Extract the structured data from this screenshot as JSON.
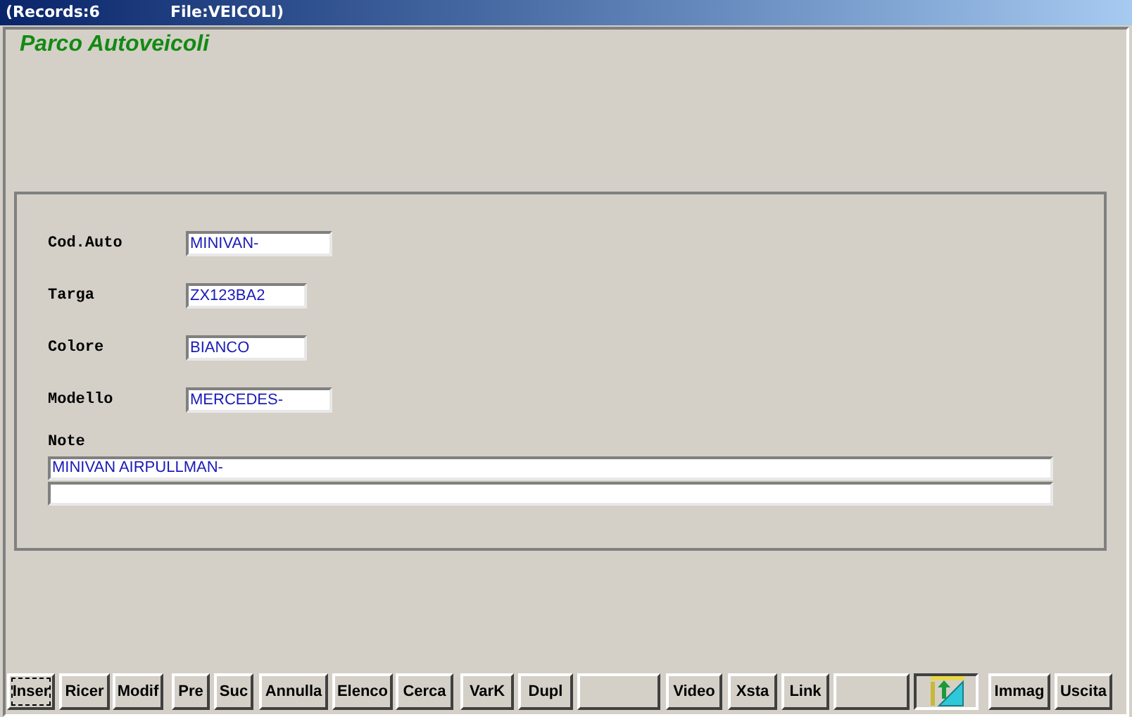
{
  "window": {
    "title_parts": [
      "(Records:6",
      "File:VEICOLI)"
    ]
  },
  "heading": "Parco Autoveicoli",
  "fields": [
    {
      "label": "Cod.Auto",
      "value": "MINIVAN-",
      "kind": "wide"
    },
    {
      "label": "Targa",
      "value": "ZX123BA2",
      "kind": "narrow"
    },
    {
      "label": "Colore",
      "value": "BIANCO",
      "kind": "narrow"
    },
    {
      "label": "Modello",
      "value": "MERCEDES-",
      "kind": "wide"
    }
  ],
  "note": {
    "label": "Note",
    "value": "MINIVAN AIRPULLMAN-"
  },
  "toolbar": [
    {
      "kind": "button",
      "label": "Inser",
      "focused": true
    },
    {
      "kind": "button",
      "label": "Ricer",
      "focused": false
    },
    {
      "kind": "button",
      "label": "Modif",
      "focused": false
    },
    {
      "kind": "button",
      "label": "Pre",
      "focused": false
    },
    {
      "kind": "button",
      "label": "Suc",
      "focused": false
    },
    {
      "kind": "button",
      "label": "Annulla",
      "focused": false
    },
    {
      "kind": "button",
      "label": "Elenco",
      "focused": false
    },
    {
      "kind": "button",
      "label": "Cerca",
      "focused": false
    },
    {
      "kind": "button",
      "label": "VarK",
      "focused": false
    },
    {
      "kind": "button",
      "label": "Dupl",
      "focused": false
    },
    {
      "kind": "blank",
      "focused": false
    },
    {
      "kind": "button",
      "label": "Video",
      "focused": false
    },
    {
      "kind": "button",
      "label": "Xsta",
      "focused": false
    },
    {
      "kind": "button",
      "label": "Link",
      "focused": false
    },
    {
      "kind": "blank",
      "focused": false
    },
    {
      "kind": "icon",
      "focused": false
    },
    {
      "kind": "button",
      "label": "Immag",
      "focused": false
    },
    {
      "kind": "button",
      "label": "Uscita",
      "focused": false
    }
  ]
}
